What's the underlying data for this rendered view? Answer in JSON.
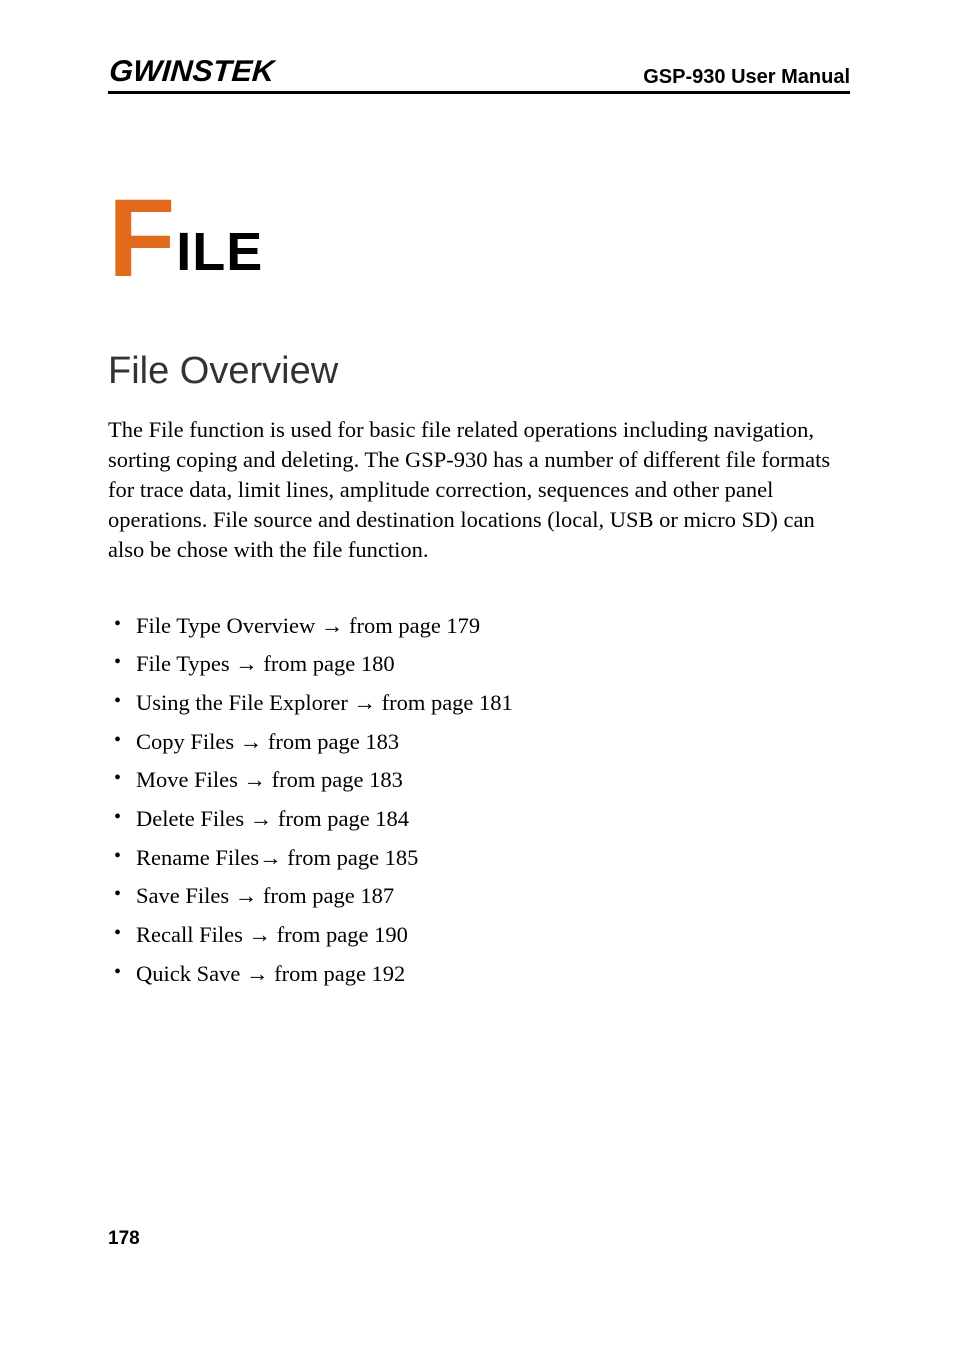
{
  "header": {
    "logo_text": "GWINSTEK",
    "right_text": "GSP-930 User Manual"
  },
  "chapter": {
    "big_letter": "F",
    "rest": "ILE"
  },
  "section": {
    "heading": "File Overview",
    "intro": "The File function is used for basic file related operations including navigation, sorting coping and deleting. The GSP-930 has a number of different file formats for trace data, limit lines, amplitude correction, sequences and other panel operations. File source and destination locations (local, USB or micro SD) can also be chose with the file function."
  },
  "toc": [
    "File Type Overview → from page 179",
    "File Types → from page 180",
    "Using the File Explorer → from page 181",
    "Copy Files → from page 183",
    "Move Files → from page 183",
    "Delete Files → from page 184",
    "Rename Files→ from page 185",
    "Save Files → from page 187",
    "Recall Files → from page 190",
    "Quick Save → from page 192"
  ],
  "page_number": "178"
}
